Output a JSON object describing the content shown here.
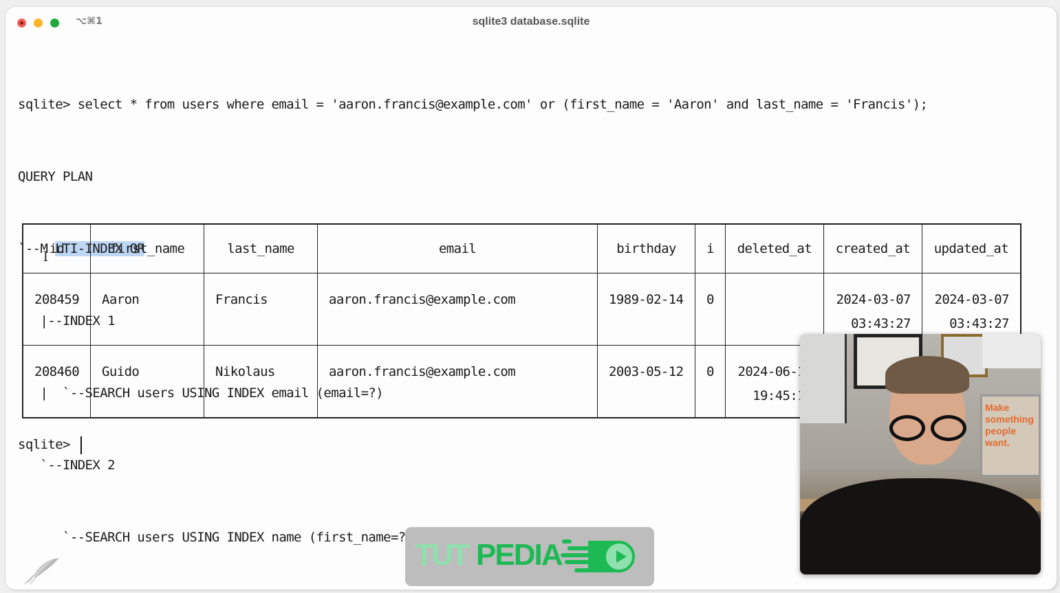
{
  "window": {
    "title": "sqlite3 database.sqlite",
    "shortcut": "⌥⌘1",
    "traffic_lights": [
      "close",
      "minimize",
      "maximize"
    ]
  },
  "terminal": {
    "command_line": "sqlite> select * from users where email = 'aaron.francis@example.com' or (first_name = 'Aaron' and last_name = 'Francis');",
    "plan_header": "QUERY PLAN",
    "plan_root_prefix": "`--M",
    "plan_root_hidden": "U",
    "plan_root_selected": "LTI-INDEX OR",
    "plan_lines": [
      "   |--INDEX 1",
      "   |  `--SEARCH users USING INDEX email (email=?)",
      "   `--INDEX 2",
      "      `--SEARCH users USING INDEX name (first_name=? AND last_name=?)"
    ],
    "prompt": "sqlite> "
  },
  "results": {
    "columns": [
      "id",
      "first_name",
      "last_name",
      "email",
      "birthday",
      "i",
      "deleted_at",
      "created_at",
      "updated_at"
    ],
    "rows": [
      [
        "208459",
        "Aaron",
        "Francis",
        "aaron.francis@example.com",
        "1989-02-14",
        "0",
        "",
        "2024-03-07 03:43:27",
        "2024-03-07 03:43:27"
      ],
      [
        "208460",
        "Guido",
        "Nikolaus",
        "aaron.francis@example.com",
        "2003-05-12",
        "0",
        "2024-06-17 19:45:19",
        "",
        ""
      ]
    ],
    "row_display": [
      {
        "created_at": [
          "2024-03-07",
          "03:43:27"
        ],
        "updated_at": [
          "2024-03-07",
          "03:43:27"
        ],
        "deleted_at": [
          "",
          ""
        ]
      },
      {
        "deleted_at": [
          "2024-06-17",
          "19:45:19"
        ],
        "created_at": [
          "",
          ""
        ],
        "updated_at": [
          "",
          ""
        ]
      }
    ]
  },
  "overlay": {
    "webcam_poster_text": "Make something people want.",
    "logo_text_1": "TUT",
    "logo_text_2": "PEDIA"
  },
  "colors": {
    "selection": "#bcd6f3",
    "logo_green": "#1db954",
    "logo_light_green": "#8fe0ad"
  }
}
